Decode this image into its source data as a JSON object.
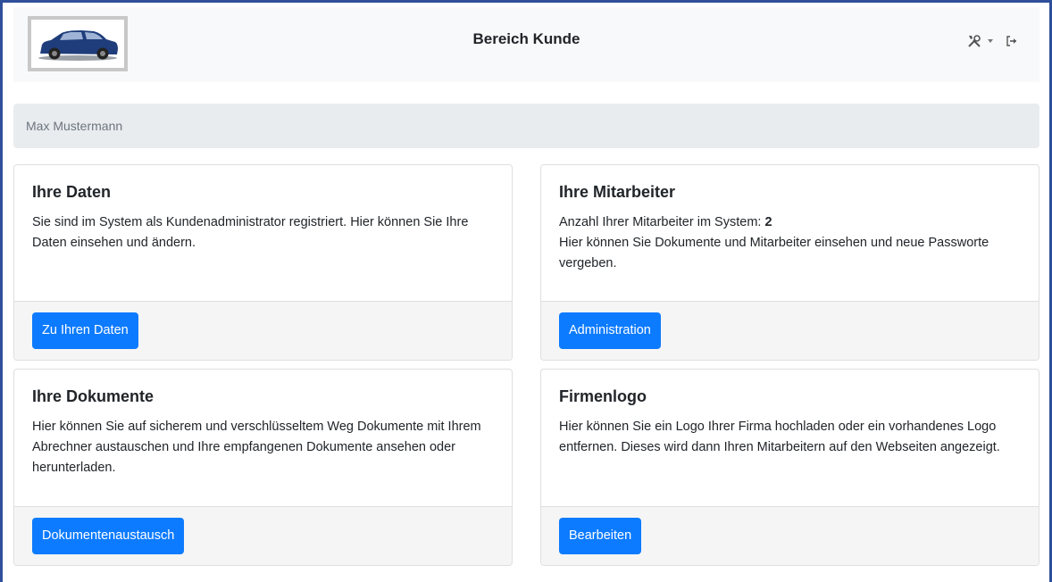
{
  "header": {
    "title": "Bereich Kunde",
    "logo_icon": "car-logo",
    "tools_icon": "tools-icon",
    "logout_icon": "logout-icon"
  },
  "breadcrumb": {
    "user_name": "Max Mustermann"
  },
  "cards": {
    "daten": {
      "title": "Ihre Daten",
      "text": "Sie sind im System als Kundenadministrator registriert. Hier können Sie Ihre Daten einsehen und ändern.",
      "button": "Zu Ihren Daten"
    },
    "mitarbeiter": {
      "title": "Ihre Mitarbeiter",
      "count_label": "Anzahl Ihrer Mitarbeiter im System:",
      "count_value": "2",
      "text": "Hier können Sie Dokumente und Mitarbeiter einsehen und neue Passworte vergeben.",
      "button": "Administration"
    },
    "dokumente": {
      "title": "Ihre Dokumente",
      "text": "Hier können Sie auf sicherem und verschlüsseltem Weg Dokumente mit Ihrem Abrechner austauschen und Ihre empfangenen Dokumente ansehen oder herunterladen.",
      "button": "Dokumentenaustausch"
    },
    "firmenlogo": {
      "title": "Firmenlogo",
      "text": "Hier können Sie ein Logo Ihrer Firma hochladen oder ein vorhandenes Logo entfernen. Dieses wird dann Ihren Mitarbeitern auf den Webseiten angezeigt.",
      "button": "Bearbeiten"
    }
  },
  "colors": {
    "primary": "#0d7bff",
    "frame": "#2f4f9a",
    "navbar_bg": "#f8f9fa",
    "breadcrumb_bg": "#e9ecef"
  }
}
